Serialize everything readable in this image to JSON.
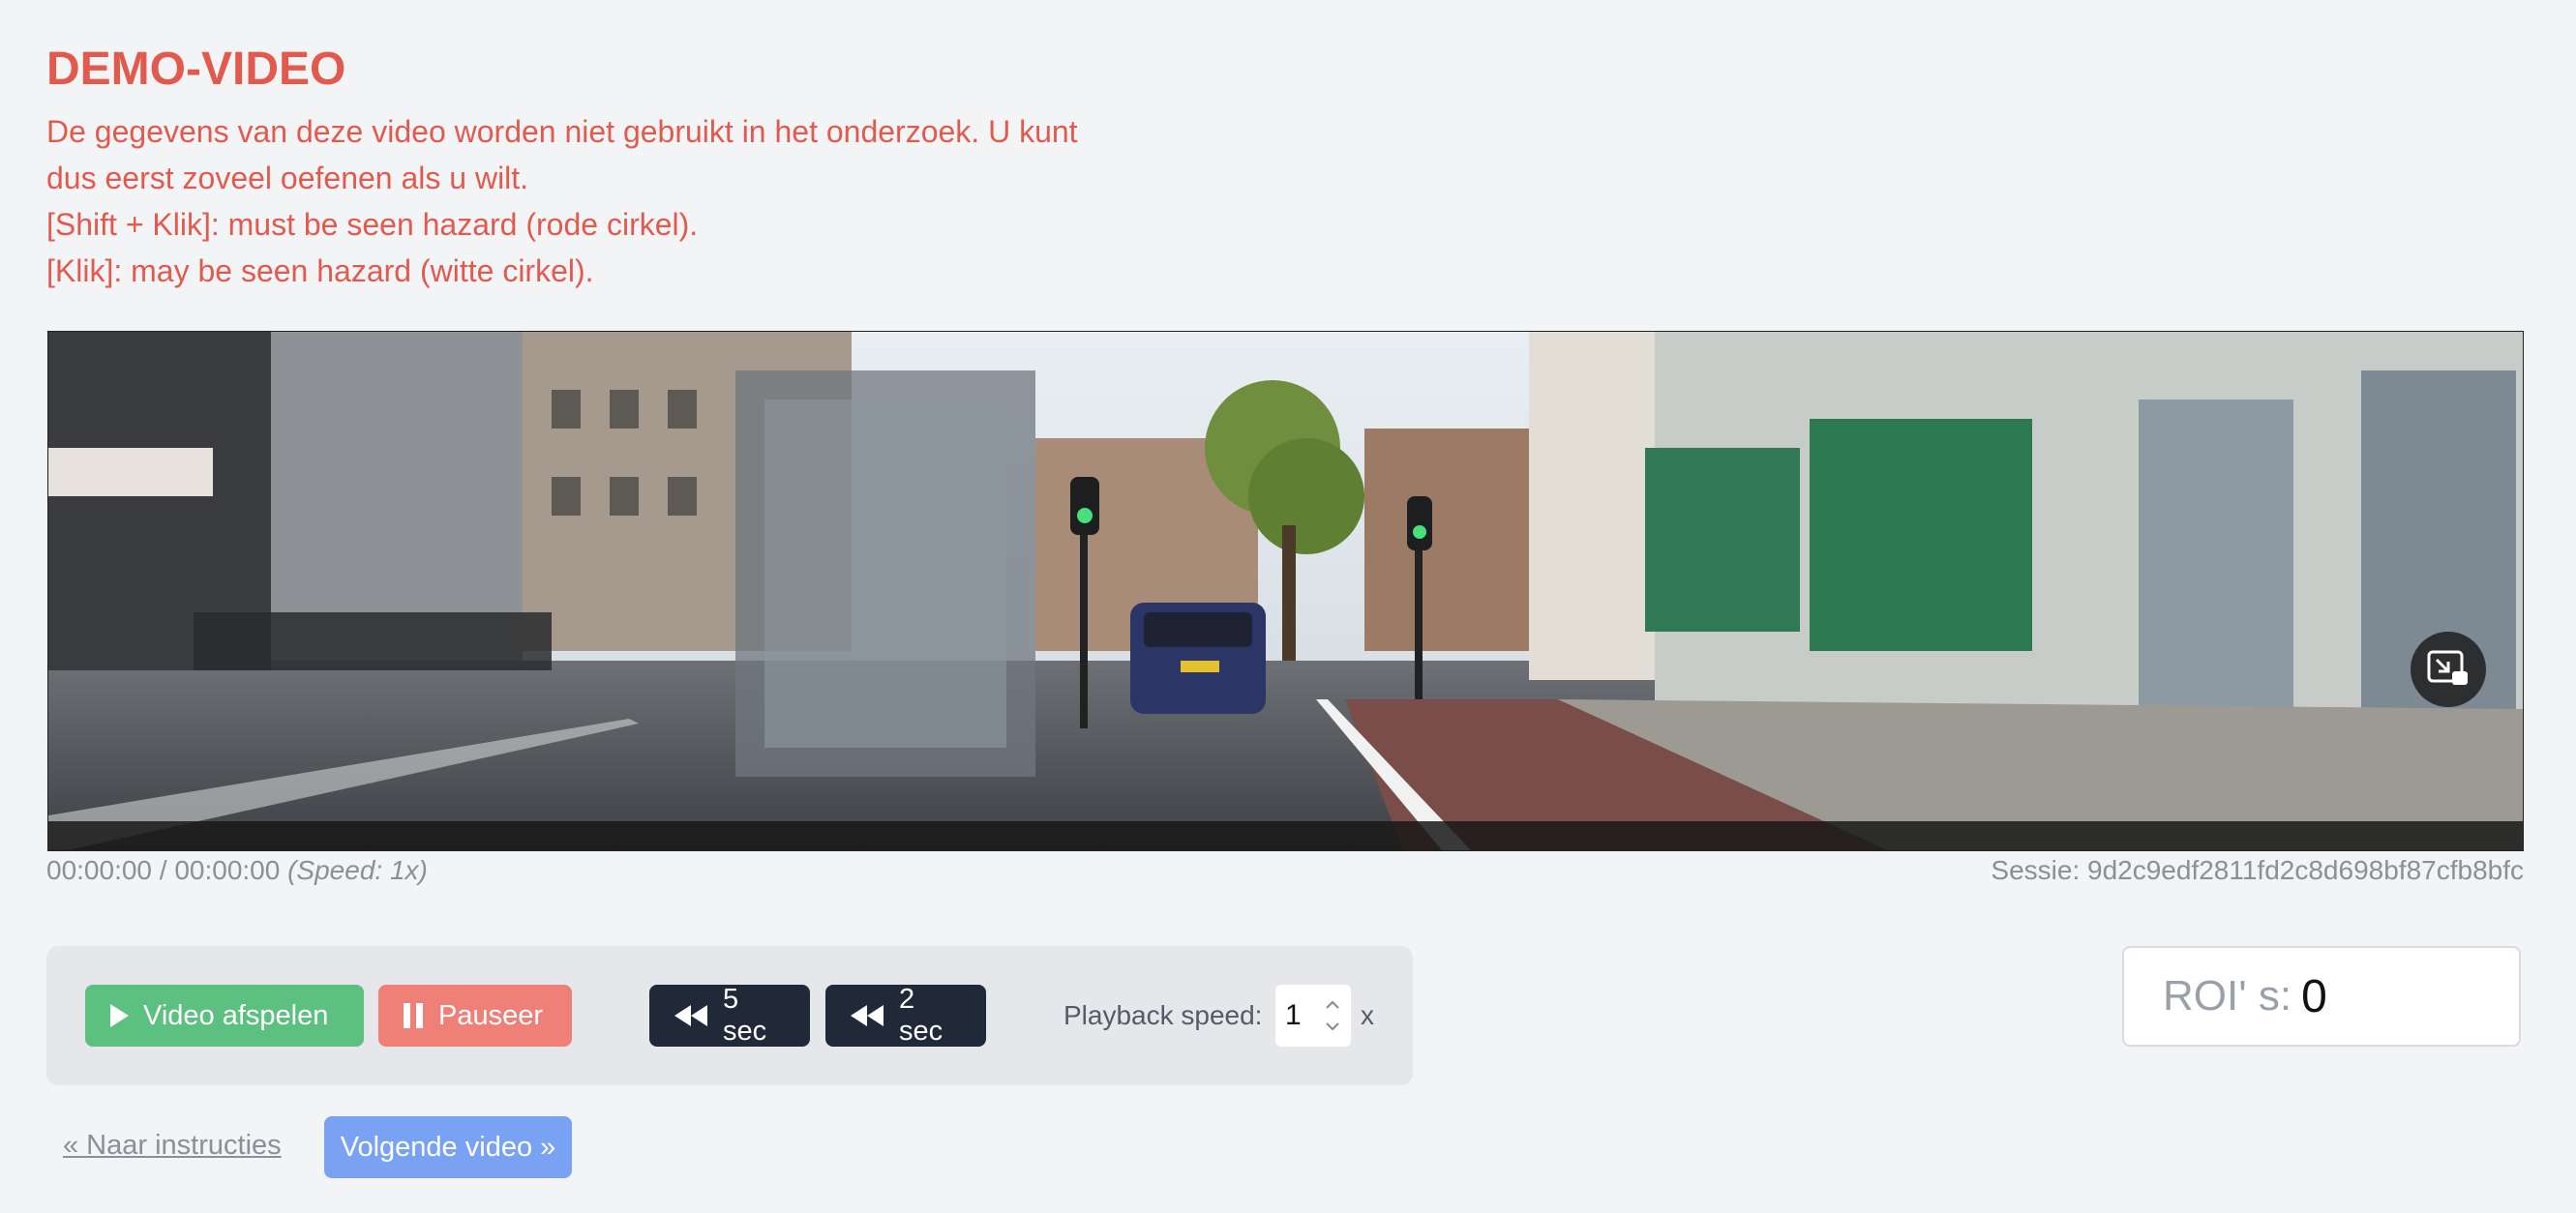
{
  "notice": {
    "title": "DEMO-VIDEO",
    "line1": "De gegevens van deze video worden niet gebruikt in het onderzoek. U kunt",
    "line2": "dus eerst zoveel oefenen als u wilt.",
    "line3": "[Shift + Klik]: must be seen hazard (rode cirkel).",
    "line4": "[Klik]: may be seen hazard (witte cirkel)."
  },
  "video": {
    "pip_icon": "picture-in-picture-exit-icon"
  },
  "status": {
    "time": "00:00:00 / 00:00:00",
    "speed": "(Speed: 1x)",
    "session": "Sessie: 9d2c9edf2811fd2c8d698bf87cfb8bfc"
  },
  "controls": {
    "play_label": "Video afspelen",
    "pause_label": "Pauseer",
    "back5_label": "5 sec",
    "back2_label": "2 sec",
    "speed_label": "Playback speed:",
    "speed_value": "1",
    "speed_suffix": "x"
  },
  "roi": {
    "label": "ROI' s:",
    "value": "0"
  },
  "nav": {
    "back_label": "« Naar instructies",
    "next_label": "Volgende video »"
  },
  "colors": {
    "notice_red": "#e25a4e",
    "play_green": "#5cc081",
    "pause_red": "#ee8077",
    "dark_button": "#1f2937",
    "next_blue": "#7aa2f4"
  }
}
